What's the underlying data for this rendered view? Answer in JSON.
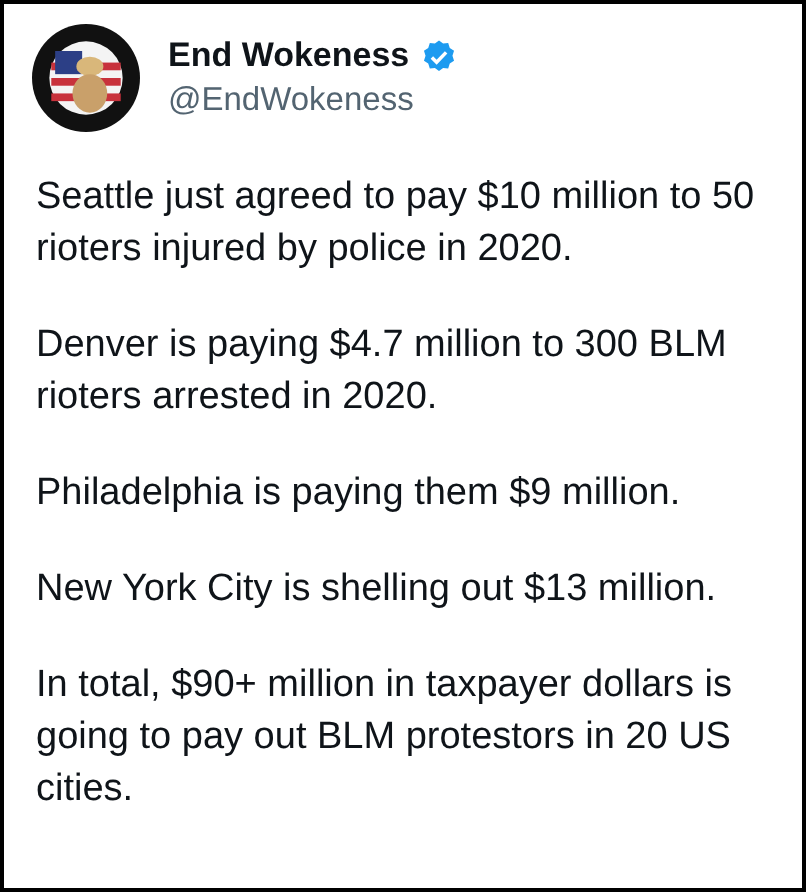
{
  "author": {
    "name": "End Wokeness",
    "verified": true,
    "handle": "@EndWokeness"
  },
  "paragraphs": [
    "Seattle just agreed to pay $10 million to 50 rioters injured by police in 2020.",
    "Denver is paying $4.7 million to 300 BLM rioters arrested in 2020.",
    "Philadelphia is paying them $9 million.",
    "New York City is shelling out $13 million.",
    "In total, $90+ million in taxpayer dollars is going to pay out BLM protestors in 20 US cities."
  ]
}
